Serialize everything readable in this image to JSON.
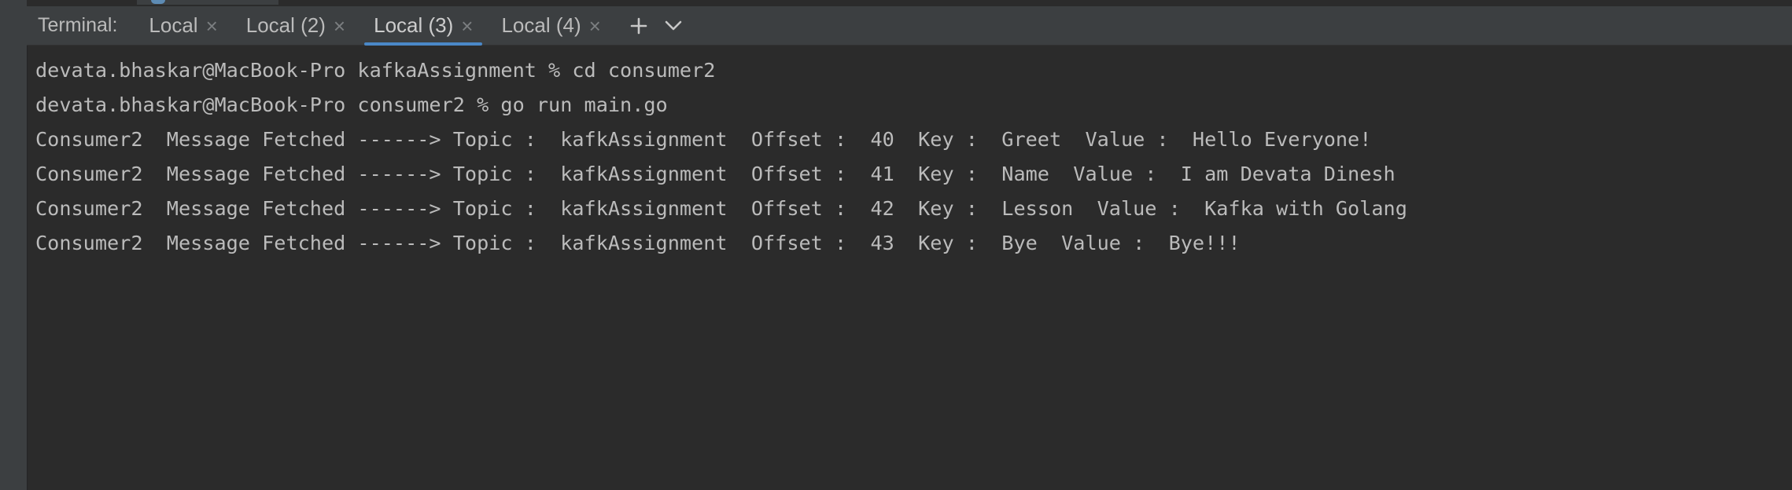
{
  "colors": {
    "background": "#2b2b2b",
    "tabbar": "#3c3f41",
    "text": "#bbbbbb",
    "active_tab_underline": "#4a88c7"
  },
  "tabbar": {
    "title": "Terminal:",
    "tabs": [
      {
        "label": "Local",
        "active": false,
        "close_icon": "close-icon"
      },
      {
        "label": "Local (2)",
        "active": false,
        "close_icon": "close-icon"
      },
      {
        "label": "Local (3)",
        "active": true,
        "close_icon": "close-icon"
      },
      {
        "label": "Local (4)",
        "active": false,
        "close_icon": "close-icon"
      }
    ],
    "new_tab_icon": "plus-icon",
    "menu_icon": "chevron-down-icon"
  },
  "terminal": {
    "lines": [
      "devata.bhaskar@MacBook-Pro kafkaAssignment % cd consumer2",
      "devata.bhaskar@MacBook-Pro consumer2 % go run main.go",
      "Consumer2  Message Fetched ------> Topic :  kafkAssignment  Offset :  40  Key :  Greet  Value :  Hello Everyone!",
      "Consumer2  Message Fetched ------> Topic :  kafkAssignment  Offset :  41  Key :  Name  Value :  I am Devata Dinesh",
      "Consumer2  Message Fetched ------> Topic :  kafkAssignment  Offset :  42  Key :  Lesson  Value :  Kafka with Golang",
      "Consumer2  Message Fetched ------> Topic :  kafkAssignment  Offset :  43  Key :  Bye  Value :  Bye!!!"
    ]
  }
}
